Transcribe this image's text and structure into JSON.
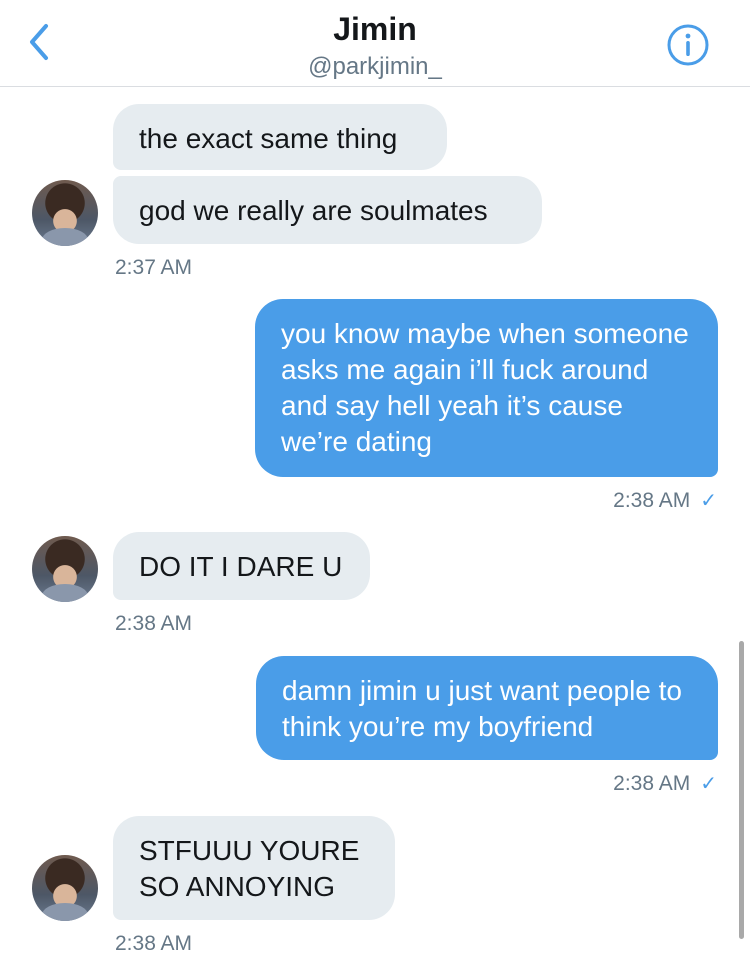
{
  "header": {
    "name": "Jimin",
    "handle": "@parkjimin_"
  },
  "messages": [
    {
      "text": "the exact same thing"
    },
    {
      "text": "god we really are soulmates"
    },
    {
      "time": "2:37 AM"
    },
    {
      "text": "you know maybe when someone asks me again i’ll fuck around and say hell yeah it’s cause we’re dating"
    },
    {
      "time": "2:38 AM",
      "read": "✓"
    },
    {
      "text": "DO IT I DARE U"
    },
    {
      "time": "2:38 AM"
    },
    {
      "text": "damn jimin u just want people to think you’re my boyfriend"
    },
    {
      "time": "2:38 AM",
      "read": "✓"
    },
    {
      "text": "STFUUU YOURE SO ANNOYING"
    },
    {
      "time": "2:38 AM"
    }
  ],
  "colors": {
    "accent": "#4a9de8",
    "incoming_bubble": "#e6ecf0",
    "meta_text": "#657786"
  },
  "icons": [
    "back-chevron-icon",
    "info-icon",
    "read-check-icon"
  ]
}
